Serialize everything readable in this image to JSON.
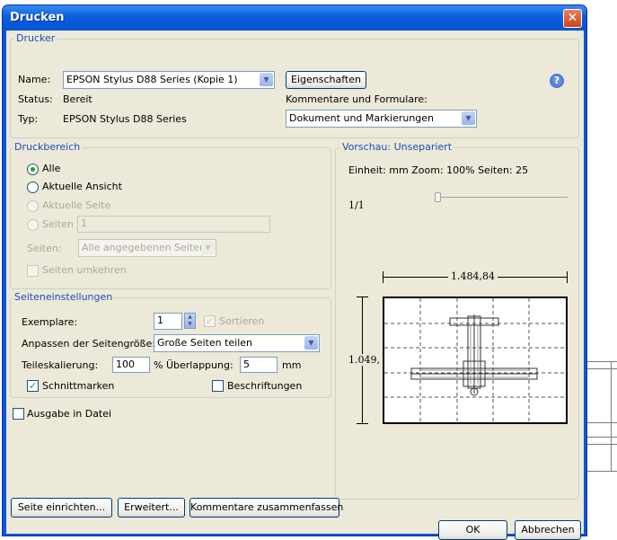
{
  "window": {
    "title": "Drucken",
    "close_glyph": "✕"
  },
  "printer": {
    "legend": "Drucker",
    "name_label": "Name:",
    "name_value": "EPSON Stylus D88 Series (Kopie 1)",
    "properties_button": "Eigenschaften",
    "status_label": "Status:",
    "status_value": "Bereit",
    "type_label": "Typ:",
    "type_value": "EPSON Stylus D88 Series",
    "comments_label": "Kommentare und Formulare:",
    "comments_value": "Dokument und Markierungen",
    "help_glyph": "?"
  },
  "range": {
    "legend": "Druckbereich",
    "all": "Alle",
    "current_view": "Aktuelle Ansicht",
    "current_page": "Aktuelle Seite",
    "pages": "Seiten",
    "pages_input": "1",
    "subset_label": "Seiten:",
    "subset_value": "Alle angegebenen Seiten",
    "reverse": "Seiten umkehren"
  },
  "page_setup": {
    "legend": "Seiteneinstellungen",
    "copies_label": "Exemplare:",
    "copies_value": "1",
    "collate": "Sortieren",
    "scaling_label": "Anpassen der Seitengröße:",
    "scaling_value": "Große Seiten teilen",
    "tile_scale_label": "Teileskalierung:",
    "tile_scale_value": "100",
    "overlap_label": "% Überlappung:",
    "overlap_value": "5",
    "overlap_unit": "mm",
    "cut_marks": "Schnittmarken",
    "labels": "Beschriftungen"
  },
  "output_to_file": "Ausgabe in Datei",
  "preview": {
    "legend": "Vorschau: Unsepariert",
    "info": "Einheit: mm Zoom: 100% Seiten: 25",
    "page_counter": "1/1",
    "width": "1.484,84",
    "height": "1.049,"
  },
  "buttons": {
    "page_setup": "Seite einrichten...",
    "advanced": "Erweitert...",
    "summarize": "Kommentare zusammenfassen",
    "ok": "OK",
    "cancel": "Abbrechen"
  }
}
